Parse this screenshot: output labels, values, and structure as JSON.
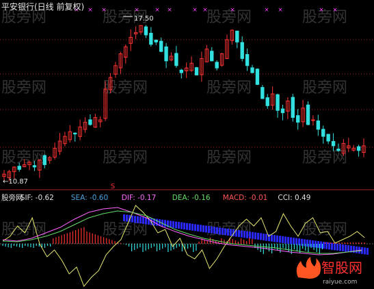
{
  "watermark": "股旁网",
  "main_panel": {
    "title": "平安银行(日线 前复权)",
    "high_label": "17.50",
    "low_label": "←10.87",
    "top_markers": "× × × × × ×",
    "signal_marker": "S"
  },
  "indicator_panel": {
    "legend": [
      {
        "label": "股旁网",
        "color": "#e0e0e0"
      },
      {
        "label": "SIF: -0.62",
        "color": "#e0e0e0"
      },
      {
        "label": "SEA: -0.60",
        "color": "#4aa3df"
      },
      {
        "label": "DIF: -0.17",
        "color": "#ff66ff"
      },
      {
        "label": "DEA: -0.16",
        "color": "#66dd66"
      },
      {
        "label": "MACD: -0.01",
        "color": "#ff5555"
      },
      {
        "label": "CCI: 0.49",
        "color": "#e0e0e0"
      }
    ]
  },
  "logo": {
    "text": "智股网",
    "url_text": "raiyue.com"
  },
  "colors": {
    "up": "#ff3333",
    "down": "#33e0e0",
    "marker": "#ff44ff",
    "grid": "#aa2222",
    "sif_bar": "#2828ff",
    "cci": "#e8e870"
  },
  "chart_data": {
    "type": "candlestick",
    "title": "平安银行(日线 前复权)",
    "price_range": [
      10.87,
      17.5
    ],
    "annotated_high": 17.5,
    "annotated_low": 10.87,
    "close_path": [
      11.0,
      11.1,
      11.3,
      11.2,
      11.4,
      11.5,
      11.3,
      11.6,
      11.4,
      11.7,
      12.1,
      12.4,
      12.6,
      12.8,
      12.7,
      13.0,
      13.2,
      13.1,
      13.4,
      13.3,
      14.6,
      15.1,
      15.6,
      16.1,
      16.4,
      16.8,
      17.0,
      17.3,
      16.9,
      16.5,
      16.6,
      16.2,
      15.8,
      16.0,
      15.6,
      15.3,
      15.5,
      15.7,
      15.2,
      15.9,
      16.3,
      15.8,
      15.5,
      16.1,
      16.7,
      17.1,
      16.6,
      15.9,
      15.6,
      15.3,
      14.8,
      14.2,
      13.9,
      14.4,
      13.7,
      13.6,
      14.1,
      13.4,
      13.2,
      13.8,
      13.1,
      13.3,
      12.9,
      12.6,
      12.4,
      12.2,
      12.0,
      12.3,
      12.2,
      12.1,
      12.0,
      12.2
    ],
    "indicators": {
      "SIF": -0.62,
      "SEA": -0.6,
      "DIF": -0.17,
      "DEA": -0.16,
      "MACD": -0.01,
      "CCI": 0.49
    }
  }
}
